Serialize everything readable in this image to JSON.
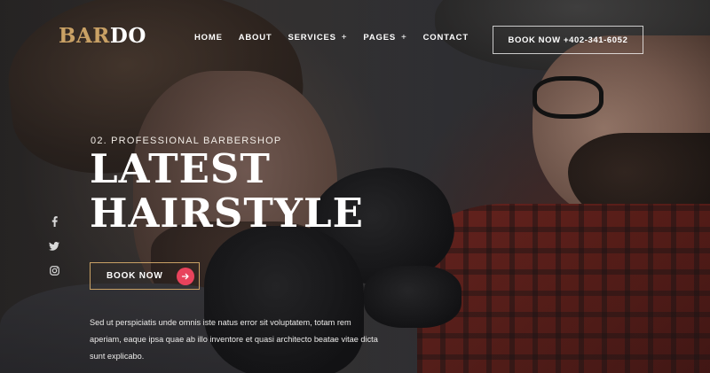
{
  "brand": {
    "logo_accent": "BAR",
    "logo_rest": "DO",
    "accent_color": "#c9a165",
    "cta_color": "#e8435c"
  },
  "nav": {
    "items": [
      {
        "label": "HOME"
      },
      {
        "label": "ABOUT"
      },
      {
        "label": "SERVICES",
        "plus": "+"
      },
      {
        "label": "PAGES",
        "plus": "+"
      },
      {
        "label": "CONTACT"
      }
    ]
  },
  "header": {
    "book_label": "BOOK NOW +402-341-6052"
  },
  "hero": {
    "eyebrow": "02. PROFESSIONAL BARBERSHOP",
    "headline_line1": "LATEST",
    "headline_line2": "HAIRSTYLE",
    "book_label": "BOOK NOW",
    "arrow_icon": "arrow-right-icon",
    "description": "Sed ut perspiciatis unde omnis iste natus error sit voluptatem, totam rem aperiam, eaque ipsa quae ab illo inventore et quasi architecto beatae vitae dicta sunt explicabo."
  },
  "social": {
    "icons": [
      "facebook-icon",
      "twitter-icon",
      "instagram-icon"
    ]
  }
}
